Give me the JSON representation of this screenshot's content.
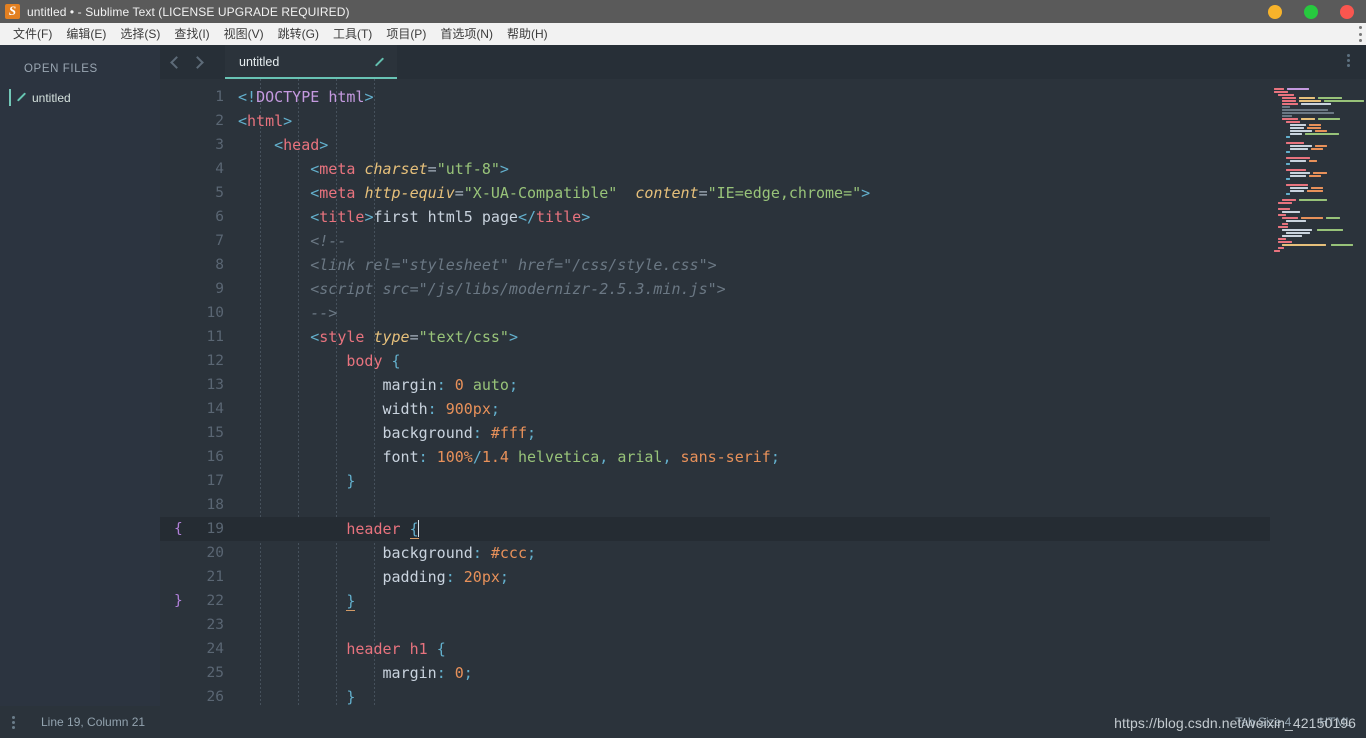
{
  "window": {
    "title": "untitled • - Sublime Text (LICENSE UPGRADE REQUIRED)",
    "logo_icon": "sublime-text-logo",
    "buttons": {
      "minimize": "minimize",
      "maximize": "maximize",
      "close": "close"
    },
    "colors": {
      "minimize": "#f7b32b",
      "maximize": "#27c93f",
      "close": "#f9564f",
      "titlebar_bg": "#5a5a5a"
    }
  },
  "menubar": {
    "items": [
      {
        "label": "文件(F)"
      },
      {
        "label": "编辑(E)"
      },
      {
        "label": "选择(S)"
      },
      {
        "label": "查找(I)"
      },
      {
        "label": "视图(V)"
      },
      {
        "label": "跳转(G)"
      },
      {
        "label": "工具(T)"
      },
      {
        "label": "项目(P)"
      },
      {
        "label": "首选项(N)"
      },
      {
        "label": "帮助(H)"
      }
    ],
    "overflow_icon": "more-vertical-icon"
  },
  "sidebar": {
    "heading": "OPEN FILES",
    "files": [
      {
        "name": "untitled",
        "icon": "pencil-icon",
        "active": true
      }
    ]
  },
  "tabbar": {
    "prev_icon": "chevron-left-icon",
    "next_icon": "chevron-right-icon",
    "menu_icon": "more-vertical-icon",
    "tabs": [
      {
        "label": "untitled",
        "dirty_icon": "pencil-icon",
        "active": true
      }
    ]
  },
  "statusbar": {
    "menu_icon": "more-vertical-icon",
    "position": "Line 19, Column 21",
    "tab_size": "Tab Size 4",
    "syntax": "HTML"
  },
  "watermark": {
    "text": "https://blog.csdn.net/weixin_42150196"
  },
  "editor": {
    "active_line": 19,
    "fold_open_line": 19,
    "fold_close_line": 22,
    "colors": {
      "background": "#2b333b",
      "active_line": "#252c33",
      "gutter_text": "#5a6673",
      "tag": "#e8737e",
      "attribute": "#e6c07b",
      "string": "#98c379",
      "punctuation": "#63b0cd",
      "comment": "#6b7884",
      "number": "#e8915a",
      "doctype": "#c59ae0",
      "accent": "#68c3b4"
    },
    "lines": [
      {
        "n": 1,
        "indent": 0,
        "tokens": [
          {
            "t": "punc",
            "v": "<!"
          },
          {
            "t": "doctype",
            "v": "DOCTYPE"
          },
          {
            "t": "text",
            "v": " "
          },
          {
            "t": "doctype",
            "v": "html"
          },
          {
            "t": "punc",
            "v": ">"
          }
        ]
      },
      {
        "n": 2,
        "indent": 0,
        "tokens": [
          {
            "t": "punc",
            "v": "<"
          },
          {
            "t": "tag",
            "v": "html"
          },
          {
            "t": "punc",
            "v": ">"
          }
        ]
      },
      {
        "n": 3,
        "indent": 1,
        "tokens": [
          {
            "t": "punc",
            "v": "<"
          },
          {
            "t": "tag",
            "v": "head"
          },
          {
            "t": "punc",
            "v": ">"
          }
        ]
      },
      {
        "n": 4,
        "indent": 2,
        "tokens": [
          {
            "t": "punc",
            "v": "<"
          },
          {
            "t": "tag",
            "v": "meta"
          },
          {
            "t": "text",
            "v": " "
          },
          {
            "t": "attr",
            "v": "charset"
          },
          {
            "t": "eq",
            "v": "="
          },
          {
            "t": "str",
            "v": "\"utf-8\""
          },
          {
            "t": "punc",
            "v": ">"
          }
        ]
      },
      {
        "n": 5,
        "indent": 2,
        "tokens": [
          {
            "t": "punc",
            "v": "<"
          },
          {
            "t": "tag",
            "v": "meta"
          },
          {
            "t": "text",
            "v": " "
          },
          {
            "t": "attr",
            "v": "http-equiv"
          },
          {
            "t": "eq",
            "v": "="
          },
          {
            "t": "str",
            "v": "\"X-UA-Compatible\""
          },
          {
            "t": "text",
            "v": "  "
          },
          {
            "t": "attr",
            "v": "content"
          },
          {
            "t": "eq",
            "v": "="
          },
          {
            "t": "str",
            "v": "\"IE=edge,chrome=\""
          },
          {
            "t": "punc",
            "v": ">"
          }
        ]
      },
      {
        "n": 6,
        "indent": 2,
        "tokens": [
          {
            "t": "punc",
            "v": "<"
          },
          {
            "t": "tag",
            "v": "title"
          },
          {
            "t": "punc",
            "v": ">"
          },
          {
            "t": "text",
            "v": "first html5 page"
          },
          {
            "t": "punc",
            "v": "</"
          },
          {
            "t": "tag",
            "v": "title"
          },
          {
            "t": "punc",
            "v": ">"
          }
        ]
      },
      {
        "n": 7,
        "indent": 2,
        "tokens": [
          {
            "t": "comment",
            "v": "<!--"
          }
        ]
      },
      {
        "n": 8,
        "indent": 2,
        "tokens": [
          {
            "t": "comment",
            "v": "<link rel=\"stylesheet\" href=\"/css/style.css\">"
          }
        ]
      },
      {
        "n": 9,
        "indent": 2,
        "tokens": [
          {
            "t": "comment",
            "v": "<script src=\"/js/libs/modernizr-2.5.3.min.js\">"
          }
        ]
      },
      {
        "n": 10,
        "indent": 2,
        "tokens": [
          {
            "t": "comment",
            "v": "-->"
          }
        ]
      },
      {
        "n": 11,
        "indent": 2,
        "tokens": [
          {
            "t": "punc",
            "v": "<"
          },
          {
            "t": "tag",
            "v": "style"
          },
          {
            "t": "text",
            "v": " "
          },
          {
            "t": "attr",
            "v": "type"
          },
          {
            "t": "eq",
            "v": "="
          },
          {
            "t": "str",
            "v": "\"text/css\""
          },
          {
            "t": "punc",
            "v": ">"
          }
        ]
      },
      {
        "n": 12,
        "indent": 3,
        "tokens": [
          {
            "t": "sel",
            "v": "body"
          },
          {
            "t": "text",
            "v": " "
          },
          {
            "t": "brace",
            "v": "{"
          }
        ]
      },
      {
        "n": 13,
        "indent": 4,
        "tokens": [
          {
            "t": "prop",
            "v": "margin"
          },
          {
            "t": "punc",
            "v": ":"
          },
          {
            "t": "text",
            "v": " "
          },
          {
            "t": "num",
            "v": "0"
          },
          {
            "t": "text",
            "v": " "
          },
          {
            "t": "val",
            "v": "auto"
          },
          {
            "t": "semi",
            "v": ";"
          }
        ]
      },
      {
        "n": 14,
        "indent": 4,
        "tokens": [
          {
            "t": "prop",
            "v": "width"
          },
          {
            "t": "punc",
            "v": ":"
          },
          {
            "t": "text",
            "v": " "
          },
          {
            "t": "num",
            "v": "900px"
          },
          {
            "t": "semi",
            "v": ";"
          }
        ]
      },
      {
        "n": 15,
        "indent": 4,
        "tokens": [
          {
            "t": "prop",
            "v": "background"
          },
          {
            "t": "punc",
            "v": ":"
          },
          {
            "t": "text",
            "v": " "
          },
          {
            "t": "num",
            "v": "#fff"
          },
          {
            "t": "semi",
            "v": ";"
          }
        ]
      },
      {
        "n": 16,
        "indent": 4,
        "tokens": [
          {
            "t": "prop",
            "v": "font"
          },
          {
            "t": "punc",
            "v": ":"
          },
          {
            "t": "text",
            "v": " "
          },
          {
            "t": "num",
            "v": "100%"
          },
          {
            "t": "punc",
            "v": "/"
          },
          {
            "t": "num",
            "v": "1.4"
          },
          {
            "t": "text",
            "v": " "
          },
          {
            "t": "val",
            "v": "helvetica"
          },
          {
            "t": "punc",
            "v": ","
          },
          {
            "t": "text",
            "v": " "
          },
          {
            "t": "val",
            "v": "arial"
          },
          {
            "t": "punc",
            "v": ","
          },
          {
            "t": "text",
            "v": " "
          },
          {
            "t": "num",
            "v": "sans-serif"
          },
          {
            "t": "semi",
            "v": ";"
          }
        ]
      },
      {
        "n": 17,
        "indent": 3,
        "tokens": [
          {
            "t": "brace",
            "v": "}"
          }
        ]
      },
      {
        "n": 18,
        "indent": 0,
        "tokens": []
      },
      {
        "n": 19,
        "indent": 3,
        "tokens": [
          {
            "t": "sel",
            "v": "header"
          },
          {
            "t": "text",
            "v": " "
          },
          {
            "t": "match",
            "v": "{"
          },
          {
            "t": "cursor",
            "v": ""
          }
        ]
      },
      {
        "n": 20,
        "indent": 4,
        "tokens": [
          {
            "t": "prop",
            "v": "background"
          },
          {
            "t": "punc",
            "v": ":"
          },
          {
            "t": "text",
            "v": " "
          },
          {
            "t": "num",
            "v": "#ccc"
          },
          {
            "t": "semi",
            "v": ";"
          }
        ]
      },
      {
        "n": 21,
        "indent": 4,
        "tokens": [
          {
            "t": "prop",
            "v": "padding"
          },
          {
            "t": "punc",
            "v": ":"
          },
          {
            "t": "text",
            "v": " "
          },
          {
            "t": "num",
            "v": "20px"
          },
          {
            "t": "semi",
            "v": ";"
          }
        ]
      },
      {
        "n": 22,
        "indent": 3,
        "tokens": [
          {
            "t": "match",
            "v": "}"
          }
        ]
      },
      {
        "n": 23,
        "indent": 0,
        "tokens": []
      },
      {
        "n": 24,
        "indent": 3,
        "tokens": [
          {
            "t": "sel",
            "v": "header h1"
          },
          {
            "t": "text",
            "v": " "
          },
          {
            "t": "brace",
            "v": "{"
          }
        ]
      },
      {
        "n": 25,
        "indent": 4,
        "tokens": [
          {
            "t": "prop",
            "v": "margin"
          },
          {
            "t": "punc",
            "v": ":"
          },
          {
            "t": "text",
            "v": " "
          },
          {
            "t": "num",
            "v": "0"
          },
          {
            "t": "semi",
            "v": ";"
          }
        ]
      },
      {
        "n": 26,
        "indent": 3,
        "tokens": [
          {
            "t": "brace",
            "v": "}"
          }
        ]
      }
    ]
  },
  "minimap": {
    "rows": [
      [
        [
          0,
          10,
          "#e8737e"
        ],
        [
          12,
          22,
          "#c59ae0"
        ]
      ],
      [
        [
          0,
          14,
          "#e8737e"
        ]
      ],
      [
        [
          4,
          16,
          "#e8737e"
        ]
      ],
      [
        [
          8,
          14,
          "#e8737e"
        ],
        [
          24,
          16,
          "#e6c07b"
        ],
        [
          42,
          24,
          "#98c379"
        ]
      ],
      [
        [
          8,
          14,
          "#e8737e"
        ],
        [
          24,
          22,
          "#e6c07b"
        ],
        [
          48,
          40,
          "#98c379"
        ]
      ],
      [
        [
          8,
          16,
          "#e8737e"
        ],
        [
          26,
          30,
          "#c9d3de"
        ]
      ],
      [
        [
          8,
          8,
          "#6b7884"
        ]
      ],
      [
        [
          8,
          46,
          "#6b7884"
        ]
      ],
      [
        [
          8,
          52,
          "#6b7884"
        ]
      ],
      [
        [
          8,
          10,
          "#6b7884"
        ]
      ],
      [
        [
          8,
          16,
          "#e8737e"
        ],
        [
          26,
          14,
          "#e6c07b"
        ],
        [
          42,
          22,
          "#98c379"
        ]
      ],
      [
        [
          12,
          14,
          "#e8737e"
        ]
      ],
      [
        [
          16,
          16,
          "#c9d3de"
        ],
        [
          34,
          12,
          "#e8915a"
        ]
      ],
      [
        [
          16,
          14,
          "#c9d3de"
        ],
        [
          32,
          14,
          "#e8915a"
        ]
      ],
      [
        [
          16,
          22,
          "#c9d3de"
        ],
        [
          40,
          12,
          "#e8915a"
        ]
      ],
      [
        [
          16,
          12,
          "#c9d3de"
        ],
        [
          30,
          34,
          "#98c379"
        ]
      ],
      [
        [
          12,
          4,
          "#63b0cd"
        ]
      ],
      [
        [
          0,
          0,
          "#2b333b"
        ]
      ],
      [
        [
          12,
          18,
          "#e8737e"
        ]
      ],
      [
        [
          16,
          22,
          "#c9d3de"
        ],
        [
          40,
          12,
          "#e8915a"
        ]
      ],
      [
        [
          16,
          18,
          "#c9d3de"
        ],
        [
          36,
          12,
          "#e8915a"
        ]
      ],
      [
        [
          12,
          4,
          "#63b0cd"
        ]
      ],
      [
        [
          0,
          0,
          "#2b333b"
        ]
      ],
      [
        [
          12,
          24,
          "#e8737e"
        ]
      ],
      [
        [
          16,
          16,
          "#c9d3de"
        ],
        [
          34,
          8,
          "#e8915a"
        ]
      ],
      [
        [
          12,
          4,
          "#63b0cd"
        ]
      ],
      [
        [
          0,
          0,
          "#2b333b"
        ]
      ],
      [
        [
          12,
          20,
          "#e8737e"
        ]
      ],
      [
        [
          16,
          20,
          "#c9d3de"
        ],
        [
          38,
          14,
          "#e8915a"
        ]
      ],
      [
        [
          16,
          16,
          "#c9d3de"
        ],
        [
          34,
          12,
          "#e8915a"
        ]
      ],
      [
        [
          12,
          4,
          "#63b0cd"
        ]
      ],
      [
        [
          0,
          0,
          "#2b333b"
        ]
      ],
      [
        [
          12,
          22,
          "#e8737e"
        ]
      ],
      [
        [
          16,
          18,
          "#c9d3de"
        ],
        [
          36,
          12,
          "#e8915a"
        ]
      ],
      [
        [
          16,
          14,
          "#c9d3de"
        ],
        [
          32,
          16,
          "#e8915a"
        ]
      ],
      [
        [
          12,
          4,
          "#63b0cd"
        ]
      ],
      [
        [
          0,
          0,
          "#2b333b"
        ]
      ],
      [
        [
          8,
          14,
          "#e8737e"
        ],
        [
          24,
          28,
          "#98c379"
        ]
      ],
      [
        [
          4,
          14,
          "#e8737e"
        ]
      ],
      [
        [
          0,
          0,
          "#2b333b"
        ]
      ],
      [
        [
          4,
          12,
          "#e8737e"
        ]
      ],
      [
        [
          8,
          18,
          "#c9d3de"
        ]
      ],
      [
        [
          4,
          8,
          "#e8737e"
        ]
      ],
      [
        [
          8,
          16,
          "#e8737e"
        ],
        [
          26,
          22,
          "#e8915a"
        ],
        [
          50,
          14,
          "#98c379"
        ]
      ],
      [
        [
          12,
          20,
          "#c9d3de"
        ]
      ],
      [
        [
          8,
          6,
          "#e8737e"
        ]
      ],
      [
        [
          4,
          10,
          "#e8737e"
        ]
      ],
      [
        [
          8,
          30,
          "#c9d3de"
        ],
        [
          42,
          26,
          "#98c379"
        ]
      ],
      [
        [
          12,
          24,
          "#c9d3de"
        ]
      ],
      [
        [
          8,
          20,
          "#c9d3de"
        ]
      ],
      [
        [
          4,
          8,
          "#e8737e"
        ]
      ],
      [
        [
          4,
          14,
          "#e8737e"
        ]
      ],
      [
        [
          8,
          44,
          "#e6c07b"
        ],
        [
          56,
          22,
          "#98c379"
        ]
      ],
      [
        [
          4,
          6,
          "#e8737e"
        ]
      ],
      [
        [
          0,
          6,
          "#e8737e"
        ]
      ]
    ]
  }
}
